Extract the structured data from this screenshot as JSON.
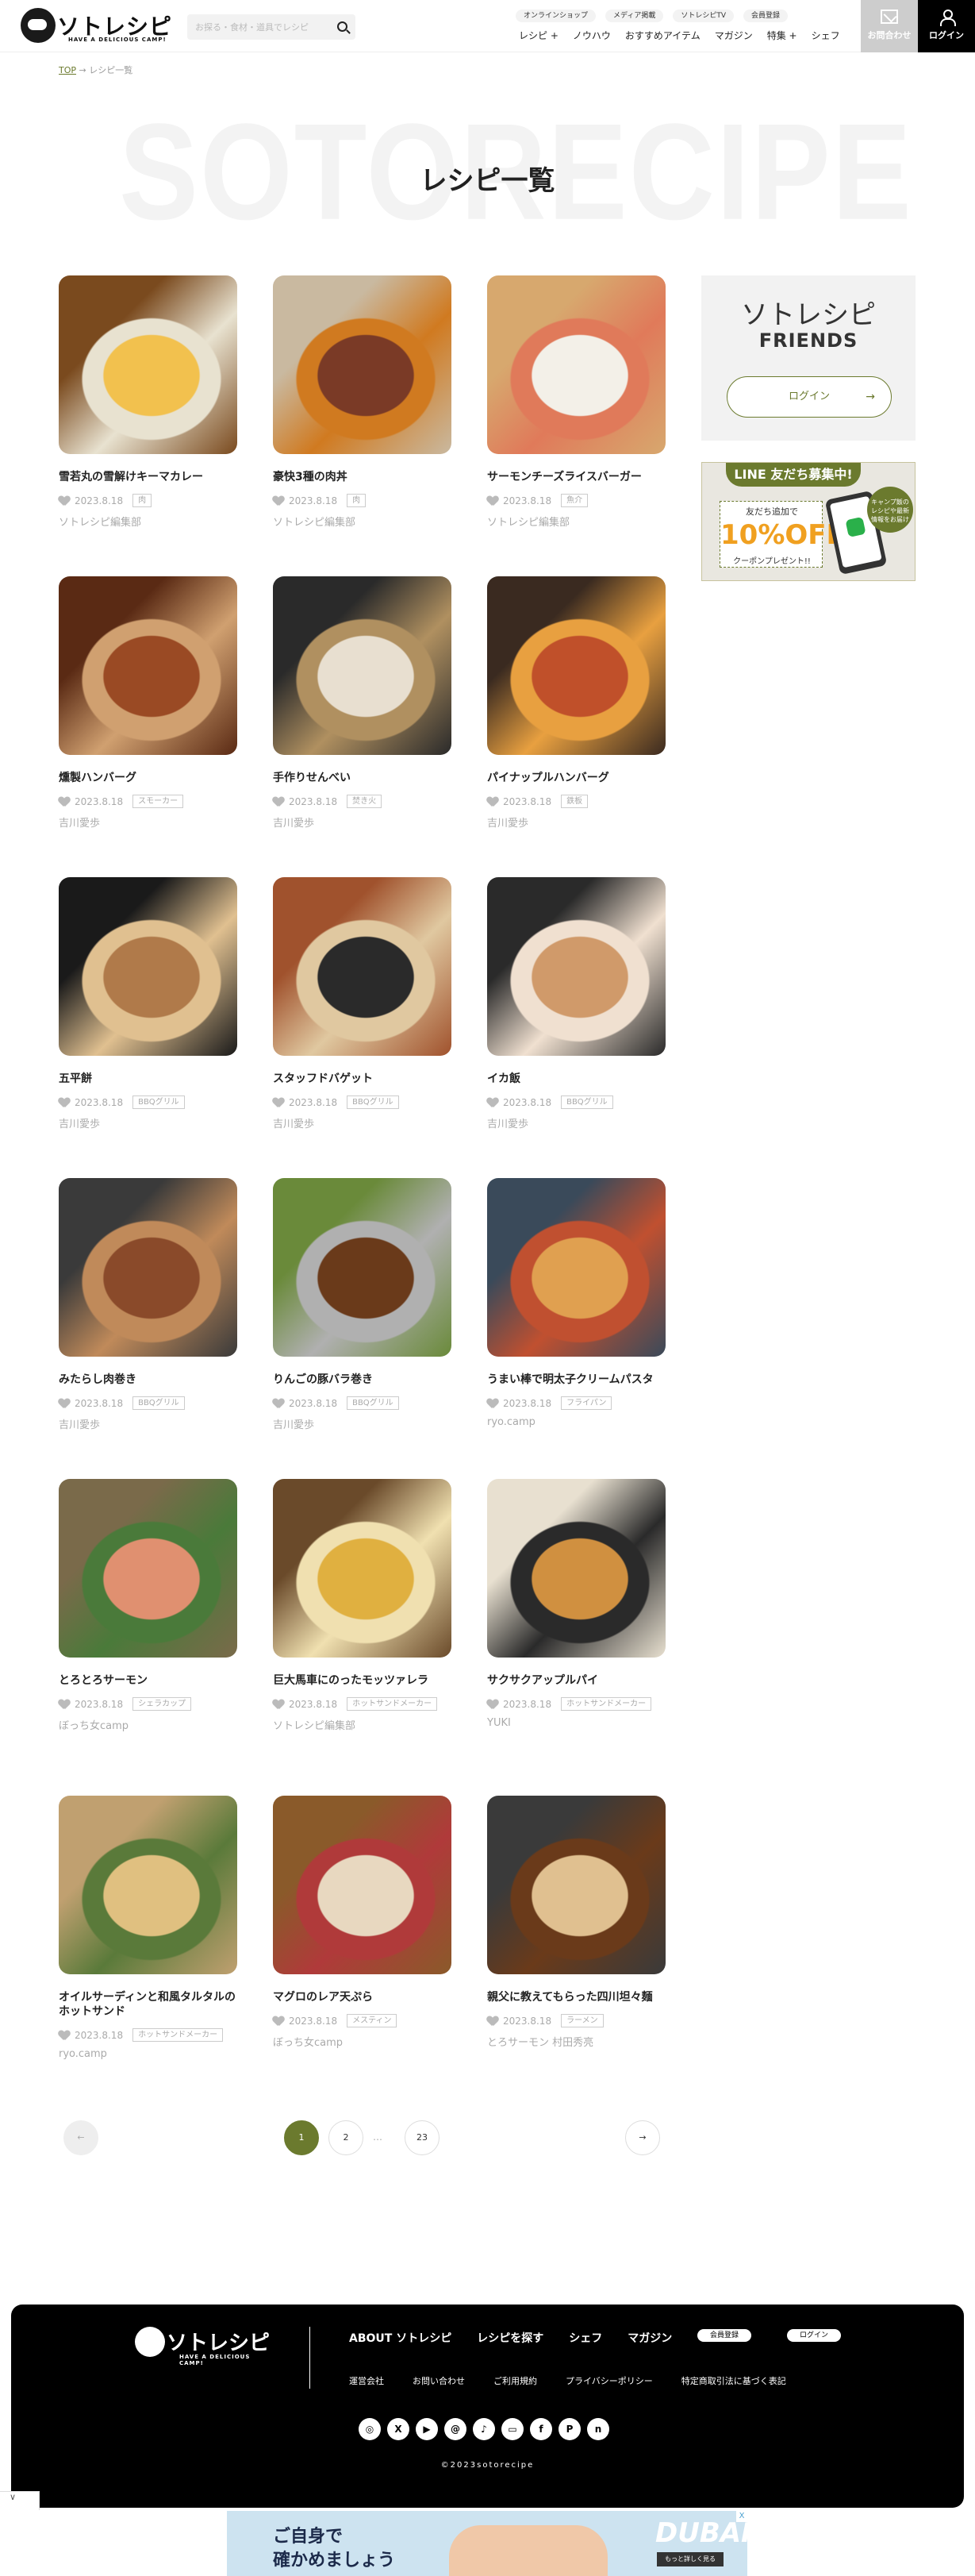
{
  "header": {
    "logo_text": "ソトレシピ",
    "logo_sub": "HAVE A DELICIOUS CAMP!",
    "search_placeholder": "お探る・食材・道具でレシピ",
    "top_links": [
      "オンラインショップ",
      "メディア掲載",
      "ソトレシピTV",
      "会員登録"
    ],
    "nav": [
      "レシピ +",
      "ノウハウ",
      "おすすめアイテム",
      "マガジン",
      "特集 +",
      "シェフ"
    ],
    "contact_label": "お問合わせ",
    "login_label": "ログイン"
  },
  "breadcrumb": {
    "home": "TOP",
    "sep": "→",
    "current": "レシピ一覧"
  },
  "page": {
    "bg_word": "SOTORECIPE",
    "title": "レシピ一覧"
  },
  "recipes": [
    {
      "name": "雪若丸の雪解けキーマカレー",
      "date": "2023.8.18",
      "tag": "肉",
      "author": "ソトレシピ編集部",
      "colors": [
        "#7a4a1e",
        "#f2c14e",
        "#e8e2d0"
      ]
    },
    {
      "name": "豪快3種の肉丼",
      "date": "2023.8.18",
      "tag": "肉",
      "author": "ソトレシピ編集部",
      "colors": [
        "#c9b9a0",
        "#7a3a26",
        "#d07a20"
      ]
    },
    {
      "name": "サーモンチーズライスバーガー",
      "date": "2023.8.18",
      "tag": "魚介",
      "author": "ソトレシピ編集部",
      "colors": [
        "#d7a86e",
        "#f3f0e8",
        "#e07a5a"
      ]
    },
    {
      "name": "燻製ハンバーグ",
      "date": "2023.8.18",
      "tag": "スモーカー",
      "author": "吉川愛歩",
      "colors": [
        "#5a2a14",
        "#9a4a24",
        "#d0a070"
      ]
    },
    {
      "name": "手作りせんべい",
      "date": "2023.8.18",
      "tag": "焚き火",
      "author": "吉川愛歩",
      "colors": [
        "#2a2a2a",
        "#e8dfd0",
        "#b09060"
      ]
    },
    {
      "name": "パイナップルハンバーグ",
      "date": "2023.8.18",
      "tag": "鉄板",
      "author": "吉川愛歩",
      "colors": [
        "#3a2a20",
        "#c0502a",
        "#e8a040"
      ]
    },
    {
      "name": "五平餅",
      "date": "2023.8.18",
      "tag": "BBQグリル",
      "author": "吉川愛歩",
      "colors": [
        "#1a1a1a",
        "#b07a4a",
        "#e0c090"
      ]
    },
    {
      "name": "スタッフドバゲット",
      "date": "2023.8.18",
      "tag": "BBQグリル",
      "author": "吉川愛歩",
      "colors": [
        "#a0522d",
        "#2a2a2a",
        "#e0c8a0"
      ]
    },
    {
      "name": "イカ飯",
      "date": "2023.8.18",
      "tag": "BBQグリル",
      "author": "吉川愛歩",
      "colors": [
        "#2a2a2a",
        "#d09a6a",
        "#f0e0d0"
      ]
    },
    {
      "name": "みたらし肉巻き",
      "date": "2023.8.18",
      "tag": "BBQグリル",
      "author": "吉川愛歩",
      "colors": [
        "#3a3a3a",
        "#8a4a2a",
        "#c08a5a"
      ]
    },
    {
      "name": "りんごの豚バラ巻き",
      "date": "2023.8.18",
      "tag": "BBQグリル",
      "author": "吉川愛歩",
      "colors": [
        "#6a8a3a",
        "#6a3a1a",
        "#b0b0b0"
      ]
    },
    {
      "name": "うまい棒で明太子クリームパスタ",
      "date": "2023.8.18",
      "tag": "フライパン",
      "author": "ryo.camp",
      "colors": [
        "#3a4a5a",
        "#e0a050",
        "#c05030"
      ]
    },
    {
      "name": "とろとろサーモン",
      "date": "2023.8.18",
      "tag": "シェラカップ",
      "author": "ぼっち女camp",
      "colors": [
        "#7a6a4a",
        "#e09070",
        "#4a7a3a"
      ]
    },
    {
      "name": "巨大馬車にのったモッツァレラ",
      "date": "2023.8.18",
      "tag": "ホットサンドメーカー",
      "author": "ソトレシピ編集部",
      "colors": [
        "#6a4a2a",
        "#e0b040",
        "#f0e0b0"
      ]
    },
    {
      "name": "サクサクアップルパイ",
      "date": "2023.8.18",
      "tag": "ホットサンドメーカー",
      "author": "YUKI",
      "colors": [
        "#e8e0d0",
        "#d09040",
        "#2a2a2a"
      ]
    },
    {
      "name": "オイルサーディンと和風タルタルのホットサンド",
      "date": "2023.8.18",
      "tag": "ホットサンドメーカー",
      "author": "ryo.camp",
      "colors": [
        "#c0a070",
        "#e0c080",
        "#5a7a3a"
      ]
    },
    {
      "name": "マグロのレア天ぷら",
      "date": "2023.8.18",
      "tag": "メスティン",
      "author": "ぼっち女camp",
      "colors": [
        "#8a5a2a",
        "#e8d8c0",
        "#b03a3a"
      ]
    },
    {
      "name": "親父に教えてもらった四川坦々麺",
      "date": "2023.8.18",
      "tag": "ラーメン",
      "author": "とろサーモン 村田秀亮",
      "colors": [
        "#3a3a3a",
        "#e0c090",
        "#6a3a1a"
      ]
    }
  ],
  "sidebar": {
    "friends_title": "ソトレシピ",
    "friends_sub": "FRIENDS",
    "friends_login": "ログイン",
    "line_title": "LINE 友だち募集中!",
    "line_c1": "友だち追加で",
    "line_c2": "10%OFF",
    "line_c3": "クーポンプレゼント!!",
    "line_bubble": "キャンプ飯の レシピや最新 情報をお届け"
  },
  "pagination": {
    "pages": [
      "1",
      "2",
      "23"
    ],
    "dots": "…",
    "current": "1",
    "prev": "←",
    "next": "→"
  },
  "footer": {
    "logo_text": "ソトレシピ",
    "logo_sub": "HAVE A DELICIOUS CAMP!",
    "main_links": [
      "ABOUT ソトレシピ",
      "レシピを探す",
      "シェフ",
      "マガジン"
    ],
    "pill_links": [
      "会員登録",
      "ログイン"
    ],
    "sub_links": [
      "運営会社",
      "お問い合わせ",
      "ご利用規約",
      "プライバシーポリシー",
      "特定商取引法に基づく表記"
    ],
    "social": [
      "instagram-icon",
      "x-icon",
      "youtube-icon",
      "threads-icon",
      "tiktok-icon",
      "line-icon",
      "facebook-icon",
      "pinterest-icon",
      "note-icon"
    ],
    "copyright": "©2023sotorecipe"
  },
  "ad": {
    "line1": "ご自身で",
    "line2": "確かめましょう",
    "brand": "DUBAI",
    "more": "もっと詳しく見る",
    "close": "X"
  },
  "scroll_tab": "∨",
  "colors": {
    "accent": "#6b7a2e",
    "footer_bg": "#000000"
  }
}
